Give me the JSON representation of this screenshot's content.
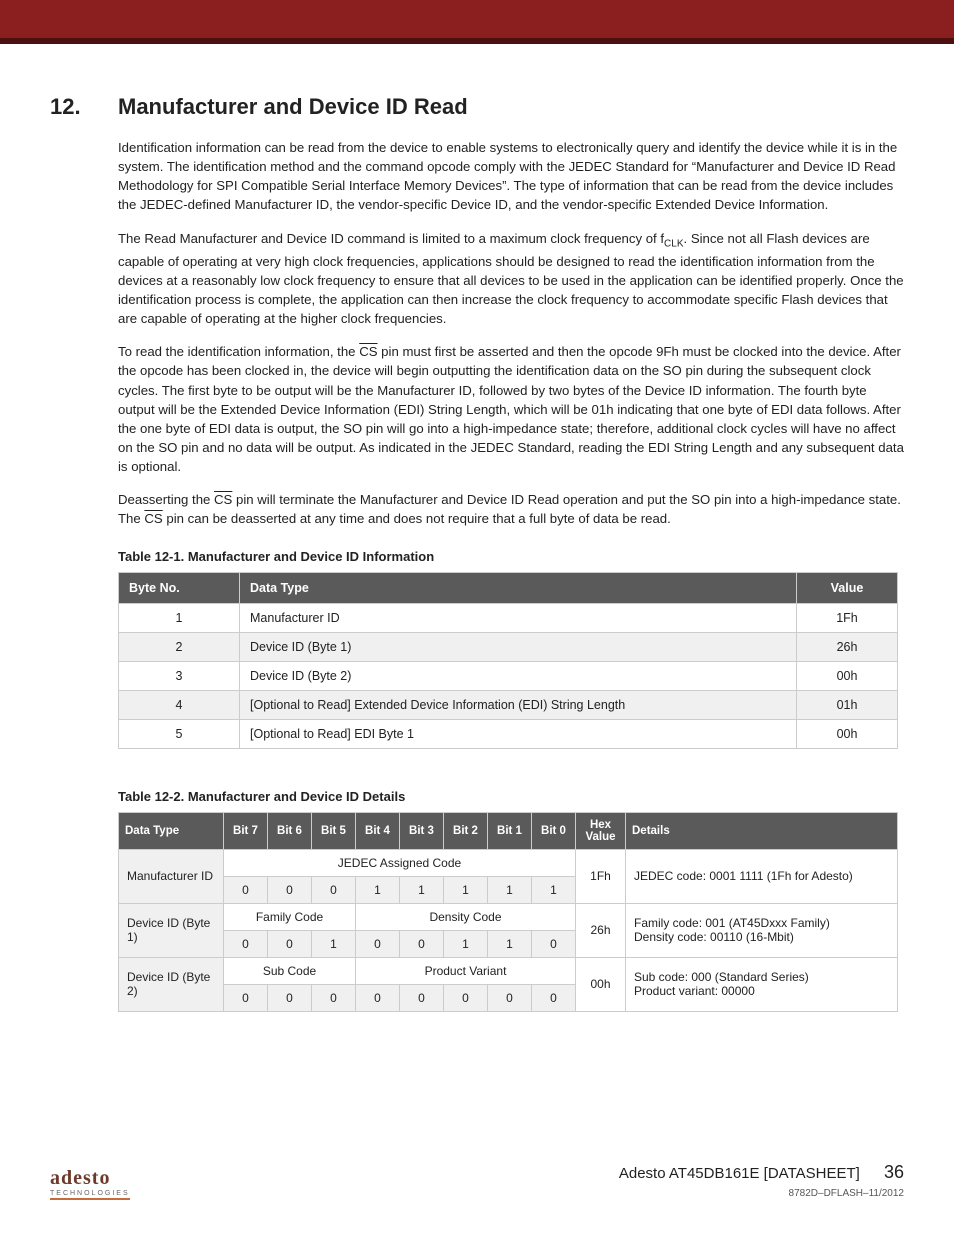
{
  "header_bar": {
    "color": "#8b1e1e"
  },
  "section": {
    "number": "12.",
    "title": "Manufacturer and Device ID Read"
  },
  "paragraphs": {
    "p1": "Identification information can be read from the device to enable systems to electronically query and identify the device while it is in the system. The identification method and the command opcode comply with the JEDEC Standard for “Manufacturer and Device ID Read Methodology for SPI Compatible Serial Interface Memory Devices”. The type of information that can be read from the device includes the JEDEC-defined Manufacturer ID, the vendor-specific Device ID, and the vendor-specific Extended Device Information.",
    "p2_a": "The Read Manufacturer and Device ID command is limited to a maximum clock frequency of f",
    "p2_sub": "CLK",
    "p2_b": ". Since not all Flash devices are capable of operating at very high clock frequencies, applications should be designed to read the identification information from the devices at a reasonably low clock frequency to ensure that all devices to be used in the application can be identified properly. Once the identification process is complete, the application can then increase the clock frequency to accommodate specific Flash devices that are capable of operating at the higher clock frequencies.",
    "p3_a": "To read the identification information, the ",
    "p3_cs": "CS",
    "p3_b": " pin must first be asserted and then the opcode 9Fh must be clocked into the device. After the opcode has been clocked in, the device will begin outputting the identification data on the SO pin during the subsequent clock cycles. The first byte to be output will be the Manufacturer ID, followed by two bytes of the Device ID information. The fourth byte output will be the Extended Device Information (EDI) String Length, which will be 01h indicating that one byte of EDI data follows. After the one byte of EDI data is output, the SO pin will go into a high-impedance state; therefore, additional clock cycles will have no affect on the SO pin and no data will be output. As indicated in the JEDEC Standard, reading the EDI String Length and any subsequent data is optional.",
    "p4_a": "Deasserting the ",
    "p4_b": " pin will terminate the Manufacturer and Device ID Read operation and put the SO pin into a high-impedance state. The ",
    "p4_c": " pin can be deasserted at any time and does not require that a full byte of data be read."
  },
  "table1": {
    "caption": "Table 12-1.   Manufacturer and Device ID Information",
    "headers": {
      "c1": "Byte No.",
      "c2": "Data Type",
      "c3": "Value"
    },
    "rows": [
      {
        "n": "1",
        "t": "Manufacturer ID",
        "v": "1Fh"
      },
      {
        "n": "2",
        "t": "Device ID (Byte 1)",
        "v": "26h"
      },
      {
        "n": "3",
        "t": "Device ID (Byte 2)",
        "v": "00h"
      },
      {
        "n": "4",
        "t": "[Optional to Read] Extended Device Information (EDI) String Length",
        "v": "01h"
      },
      {
        "n": "5",
        "t": "[Optional to Read] EDI Byte 1",
        "v": "00h"
      }
    ]
  },
  "table2": {
    "caption": "Table 12-2.   Manufacturer and Device ID Details",
    "headers": {
      "dt": "Data Type",
      "b7": "Bit 7",
      "b6": "Bit 6",
      "b5": "Bit 5",
      "b4": "Bit 4",
      "b3": "Bit 3",
      "b2": "Bit 2",
      "b1": "Bit 1",
      "b0": "Bit 0",
      "hex": "Hex Value",
      "det": "Details"
    },
    "rows": [
      {
        "label": "Manufacturer ID",
        "span_a": "JEDEC Assigned Code",
        "bits": [
          "0",
          "0",
          "0",
          "1",
          "1",
          "1",
          "1",
          "1"
        ],
        "hex": "1Fh",
        "details": "JEDEC code:   0001 1111 (1Fh for Adesto)"
      },
      {
        "label": "Device ID (Byte 1)",
        "span_a": "Family Code",
        "span_b": "Density Code",
        "bits": [
          "0",
          "0",
          "1",
          "0",
          "0",
          "1",
          "1",
          "0"
        ],
        "hex": "26h",
        "details_a": "Family code:    001 (AT45Dxxx Family)",
        "details_b": "Density code:  00110 (16-Mbit)"
      },
      {
        "label": "Device ID (Byte 2)",
        "span_a": "Sub Code",
        "span_b": "Product Variant",
        "bits": [
          "0",
          "0",
          "0",
          "0",
          "0",
          "0",
          "0",
          "0"
        ],
        "hex": "00h",
        "details_a": "Sub code:         000 (Standard Series)",
        "details_b": "Product variant: 00000"
      }
    ]
  },
  "footer": {
    "logo": "adesto",
    "logo_sub": "TECHNOLOGIES",
    "doc_title": "Adesto AT45DB161E [DATASHEET]",
    "page_no": "36",
    "doc_id": "8782D–DFLASH–11/2012"
  }
}
